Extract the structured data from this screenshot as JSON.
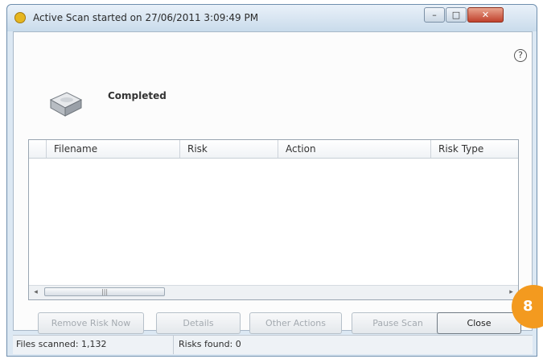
{
  "window": {
    "title": "Active Scan started on 27/06/2011 3:09:49 PM",
    "controls": {
      "minimize": "–",
      "maximize": "□",
      "close": "✕"
    }
  },
  "help": {
    "label": "?"
  },
  "scan": {
    "status": "Completed"
  },
  "results_table": {
    "columns": [
      "",
      "Filename",
      "Risk",
      "Action",
      "Risk Type"
    ],
    "rows": []
  },
  "scrollbar": {
    "left_arrow": "◂",
    "right_arrow": "▸",
    "grip": "|||"
  },
  "buttons": {
    "remove_risk": "Remove Risk Now",
    "details": "Details",
    "other_actions": "Other Actions",
    "pause_scan": "Pause Scan",
    "close": "Close"
  },
  "status_bar": {
    "files_scanned": "Files scanned: 1,132",
    "risks_found": "Risks found: 0"
  },
  "badge": {
    "number": "8"
  },
  "colors": {
    "badge": "#f39a1f",
    "window_frame": "#dce8f3"
  }
}
